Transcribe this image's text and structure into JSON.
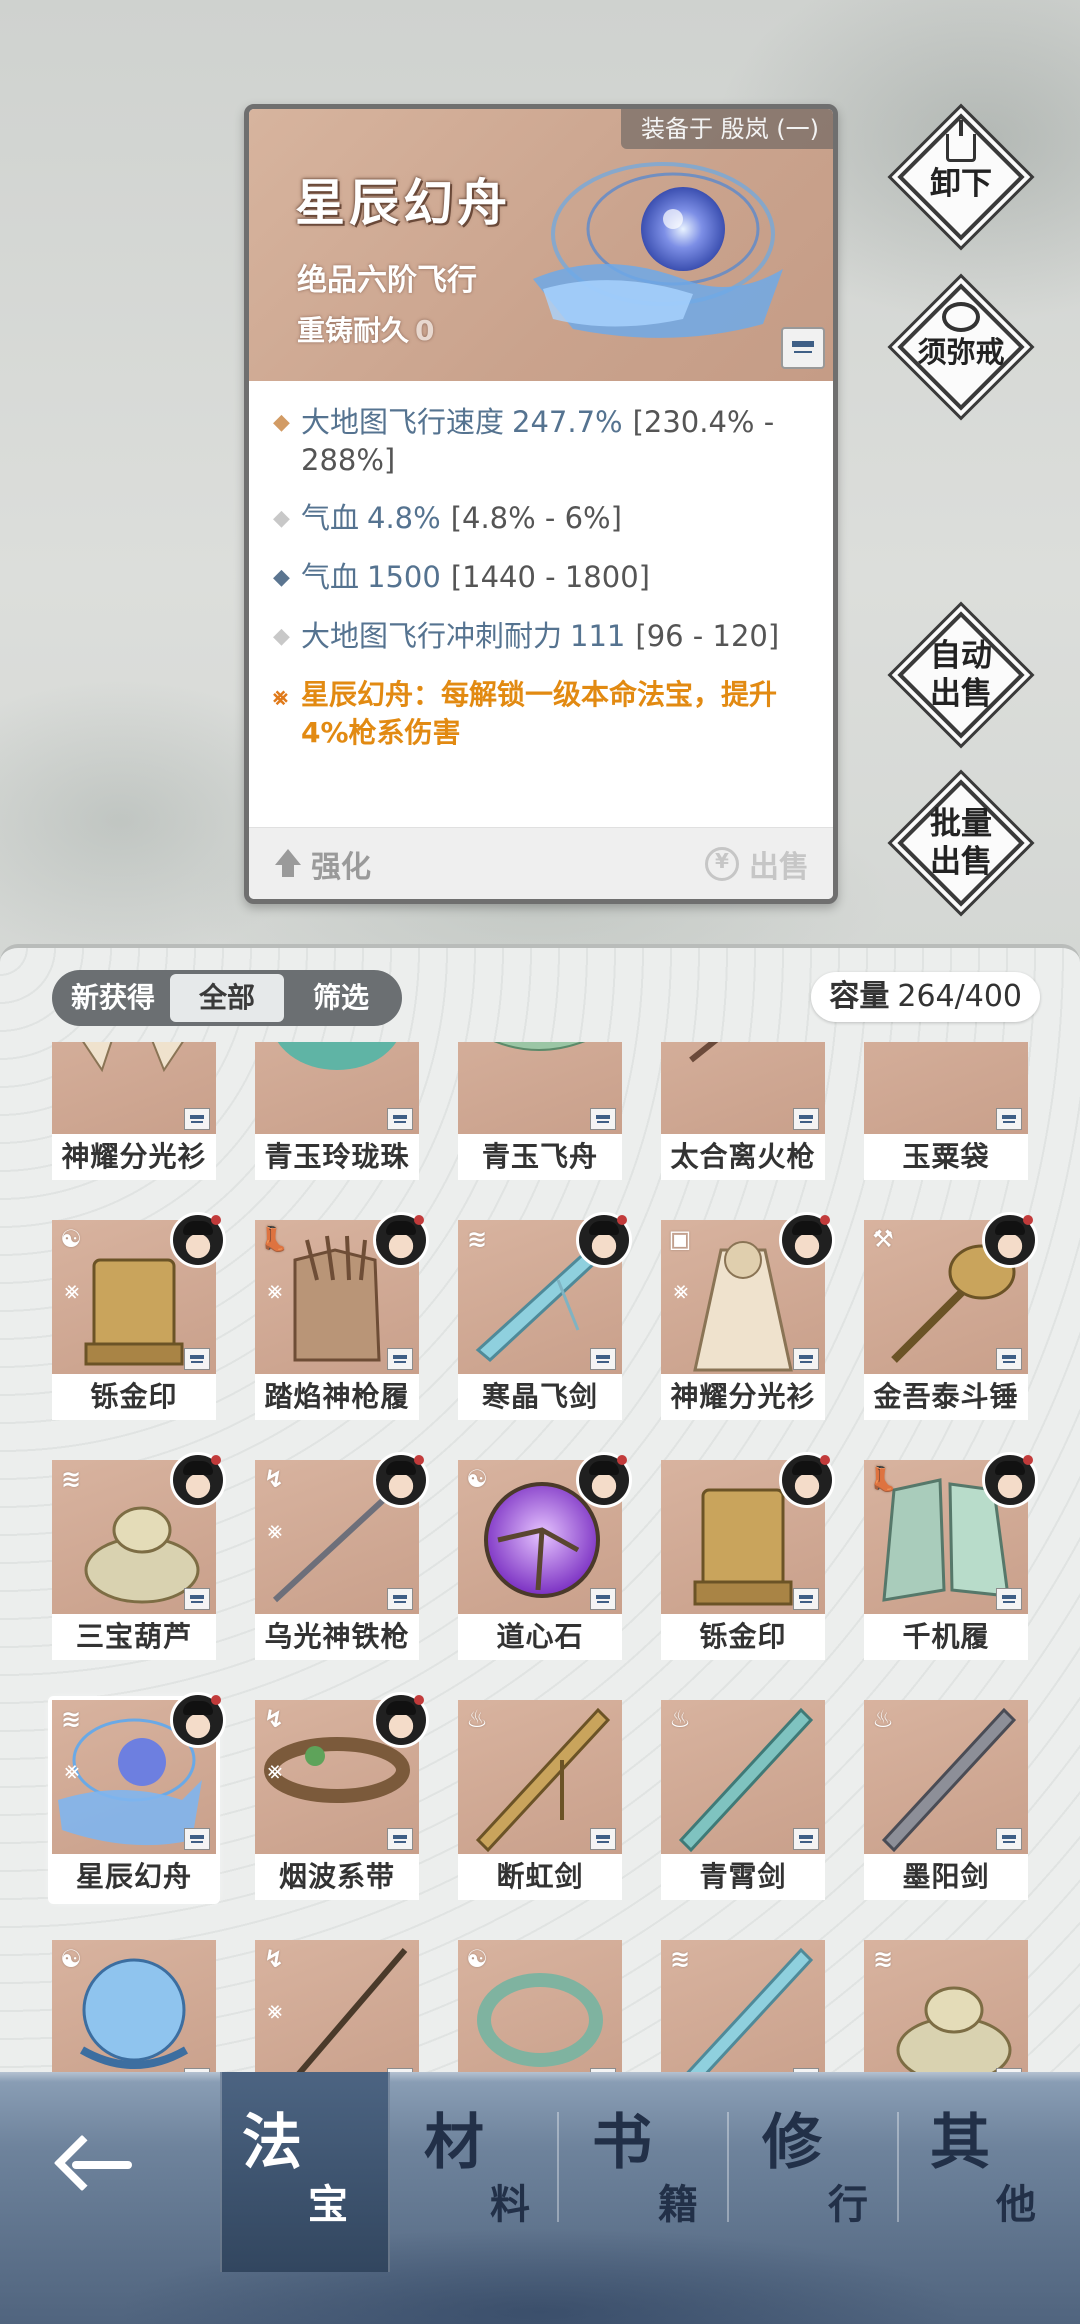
{
  "detail": {
    "equipped_by": "装备于 殷岚 (一)",
    "title": "星辰幻舟",
    "grade": "绝品六阶飞行",
    "reforge_label": "重铸耐久",
    "reforge_value": "0",
    "stats": [
      {
        "name": "大地图飞行速度",
        "value": "247.7%",
        "range": "[230.4% - 288%]",
        "bullet_color": "#d29b64"
      },
      {
        "name": "气血",
        "value": "4.8%",
        "range": "[4.8% - 6%]",
        "bullet_color": "#c8c8c8"
      },
      {
        "name": "气血",
        "value": "1500",
        "range": "[1440 - 1800]",
        "bullet_color": "#5b7590"
      },
      {
        "name": "大地图飞行冲刺耐力",
        "value": "111",
        "range": "[96 - 120]",
        "bullet_color": "#c8c8c8"
      }
    ],
    "special_effect": "星辰幻舟：每解锁一级本命法宝，提升4%枪系伤害",
    "strengthen_label": "强化",
    "sell_label": "出售"
  },
  "side_buttons": {
    "unequip": "卸下",
    "ring": "须弥戒",
    "auto_sell_1": "自动",
    "auto_sell_2": "出售",
    "batch_sell_1": "批量",
    "batch_sell_2": "出售"
  },
  "inventory": {
    "filters": [
      "新获得",
      "全部",
      "筛选"
    ],
    "active_filter": "全部",
    "capacity_label": "容量",
    "capacity_value": "264/400",
    "items": [
      {
        "name": "神耀分光衫"
      },
      {
        "name": "青玉玲珑珠"
      },
      {
        "name": "青玉飞舟"
      },
      {
        "name": "太合离火枪"
      },
      {
        "name": "玉粟袋"
      },
      {
        "name": "铄金印"
      },
      {
        "name": "踏焰神枪履"
      },
      {
        "name": "寒晶飞剑"
      },
      {
        "name": "神耀分光衫"
      },
      {
        "name": "金吾泰斗锤"
      },
      {
        "name": "三宝葫芦"
      },
      {
        "name": "乌光神铁枪"
      },
      {
        "name": "道心石"
      },
      {
        "name": "铄金印"
      },
      {
        "name": "千机履"
      },
      {
        "name": "星辰幻舟"
      },
      {
        "name": "烟波系带"
      },
      {
        "name": "断虹剑"
      },
      {
        "name": "青霄剑"
      },
      {
        "name": "墨阳剑"
      },
      {
        "name": ""
      },
      {
        "name": ""
      },
      {
        "name": ""
      },
      {
        "name": ""
      },
      {
        "name": ""
      }
    ]
  },
  "nav": {
    "tabs": [
      {
        "big": "法",
        "small": "宝"
      },
      {
        "big": "材",
        "small": "料"
      },
      {
        "big": "书",
        "small": "籍"
      },
      {
        "big": "修",
        "small": "行"
      },
      {
        "big": "其",
        "small": "他"
      }
    ],
    "active_tab": 0
  }
}
